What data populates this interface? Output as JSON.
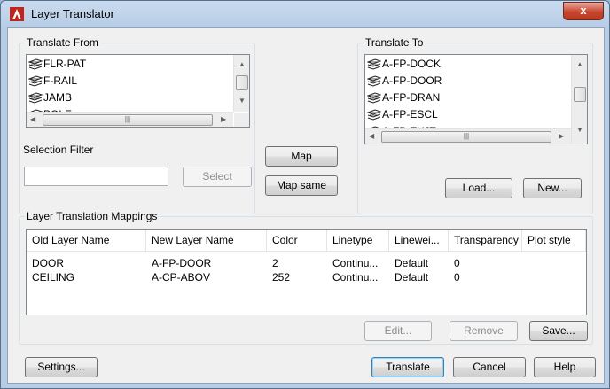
{
  "window": {
    "title": "Layer Translator",
    "close_label": "x"
  },
  "translate_from": {
    "label": "Translate From",
    "items": [
      "FLR-PAT",
      "F-RAIL",
      "JAMB",
      "POLE"
    ]
  },
  "translate_to": {
    "label": "Translate To",
    "items": [
      "A-FP-DOCK",
      "A-FP-DOOR",
      "A-FP-DRAN",
      "A-FP-ESCL",
      "A-FP-EXJT"
    ]
  },
  "selection_filter": {
    "label": "Selection Filter",
    "value": "",
    "select_label": "Select"
  },
  "buttons": {
    "map": "Map",
    "map_same": "Map same",
    "load": "Load...",
    "new": "New...",
    "edit": "Edit...",
    "remove": "Remove",
    "save": "Save...",
    "settings": "Settings...",
    "translate": "Translate",
    "cancel": "Cancel",
    "help": "Help"
  },
  "mappings": {
    "label": "Layer Translation Mappings",
    "columns": [
      "Old Layer Name",
      "New Layer Name",
      "Color",
      "Linetype",
      "Linewei...",
      "Transparency",
      "Plot style"
    ],
    "rows": [
      [
        "DOOR",
        "A-FP-DOOR",
        "2",
        "Continu...",
        "Default",
        "0",
        ""
      ],
      [
        "CEILING",
        "A-CP-ABOV",
        "252",
        "Continu...",
        "Default",
        "0",
        ""
      ]
    ]
  },
  "colors": {
    "title_bar": "#b7cde6",
    "close_button": "#c8452d",
    "client": "#f0f0f0"
  },
  "icons": {
    "app": "autocad-icon",
    "layer": "layer-stack-icon"
  }
}
